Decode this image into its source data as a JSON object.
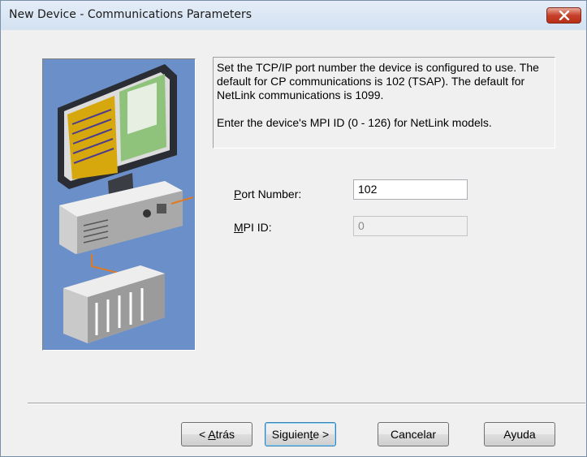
{
  "window": {
    "title": "New Device - Communications Parameters",
    "close_icon": "close-icon"
  },
  "illustration": {
    "icon": "computer-network-illustration"
  },
  "description": {
    "paragraph1": "Set the TCP/IP port number the device is configured to use.  The default for CP communications is 102 (TSAP). The default for NetLink communications is 1099.",
    "paragraph2": "Enter the device's MPI ID (0 - 126) for NetLink models."
  },
  "fields": {
    "port_number": {
      "label_prefix": "P",
      "label_rest": "ort Number:",
      "value": "102"
    },
    "mpi_id": {
      "label_prefix": "M",
      "label_rest": "PI ID:",
      "value": "0",
      "disabled": true
    }
  },
  "buttons": {
    "back": {
      "pre": "< ",
      "accel": "A",
      "post": "trás"
    },
    "next": {
      "pre": "Siguien",
      "accel": "t",
      "post": "e >"
    },
    "cancel": "Cancelar",
    "help": "Ayuda"
  }
}
